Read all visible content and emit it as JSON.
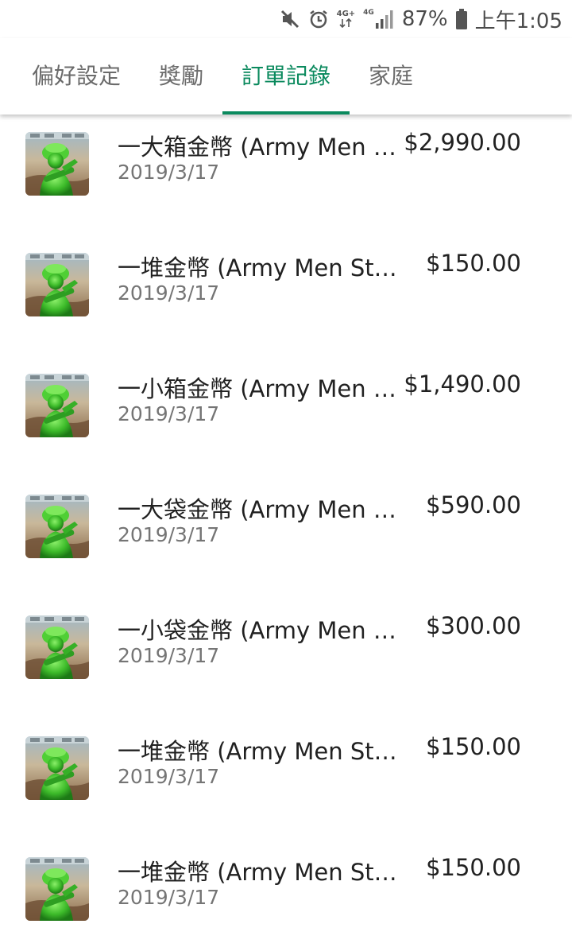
{
  "status_bar": {
    "battery": "87%",
    "time": "上午1:05",
    "network_top": "4G+",
    "network_side": "4G",
    "icons": [
      "mute-icon",
      "alarm-icon",
      "signal-icon",
      "battery-icon"
    ]
  },
  "tabs": [
    {
      "label": "偏好設定",
      "active": false
    },
    {
      "label": "獎勵",
      "active": false
    },
    {
      "label": "訂單記錄",
      "active": true
    },
    {
      "label": "家庭",
      "active": false
    }
  ],
  "orders": [
    {
      "title": "一大箱金幣 (Army Men Strike)",
      "date": "2019/3/17",
      "price": "$2,990.00"
    },
    {
      "title": "一堆金幣 (Army Men Strike)",
      "date": "2019/3/17",
      "price": "$150.00"
    },
    {
      "title": "一小箱金幣 (Army Men Strike)",
      "date": "2019/3/17",
      "price": "$1,490.00"
    },
    {
      "title": "一大袋金幣 (Army Men Strike)",
      "date": "2019/3/17",
      "price": "$590.00"
    },
    {
      "title": "一小袋金幣 (Army Men Strike)",
      "date": "2019/3/17",
      "price": "$300.00"
    },
    {
      "title": "一堆金幣 (Army Men Strike)",
      "date": "2019/3/17",
      "price": "$150.00"
    },
    {
      "title": "一堆金幣 (Army Men Strike)",
      "date": "2019/3/17",
      "price": "$150.00"
    }
  ],
  "colors": {
    "accent": "#0b8a5e",
    "text_primary": "#212121",
    "text_secondary": "#757575",
    "tab_inactive": "#6b6b6b"
  }
}
